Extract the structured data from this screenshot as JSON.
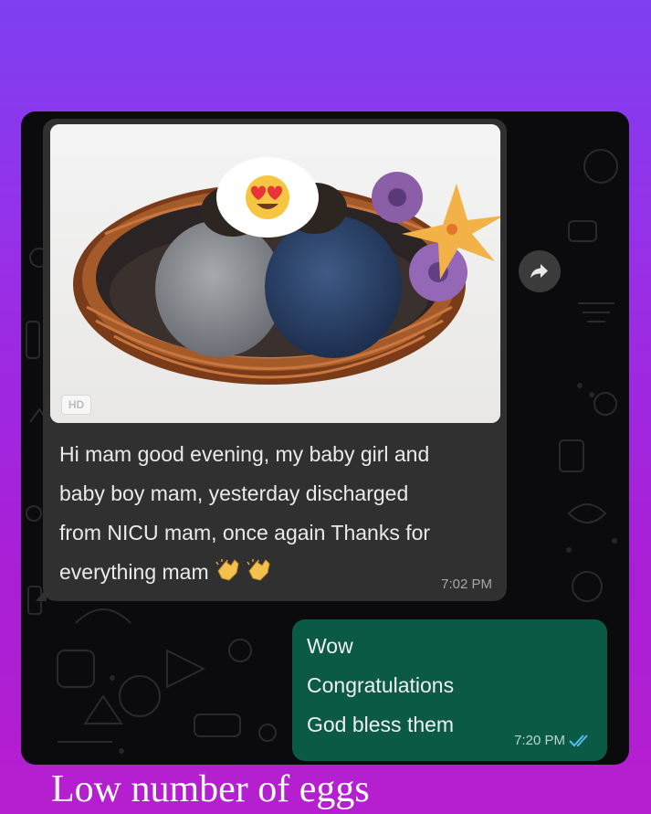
{
  "chat": {
    "incoming": {
      "badge": "HD",
      "text_lines": [
        "Hi mam good evening, my baby girl and",
        "baby boy mam, yesterday discharged",
        "from NICU mam, once again Thanks for",
        "everything mam"
      ],
      "time": "7:02 PM"
    },
    "outgoing": {
      "lines": [
        "Wow",
        "Congratulations",
        "God bless them"
      ],
      "time": "7:20 PM",
      "status_icon": "double-check-icon"
    },
    "forward_icon": "forward-arrow-icon"
  },
  "caption": "Low number of eggs",
  "colors": {
    "background_top": "#7f3ff2",
    "background_bottom": "#b61fcf",
    "incoming_bubble": "#303030",
    "outgoing_bubble": "#0a5a46",
    "read_tick": "#53bdeb"
  }
}
